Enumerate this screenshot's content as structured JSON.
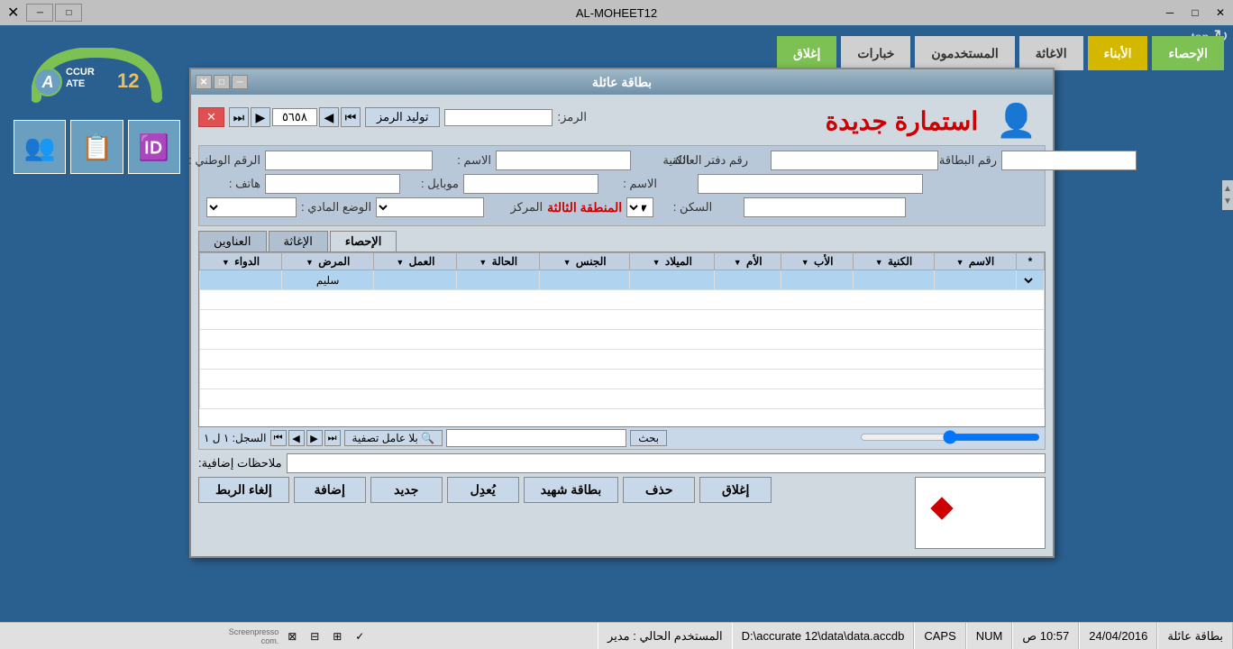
{
  "window": {
    "title": "AL-MOHEET12",
    "close_btn": "✕",
    "minimize_btn": "─",
    "maximize_btn": "□"
  },
  "top_right": {
    "label": "top",
    "refresh_icon": "↻"
  },
  "logo": {
    "text": "ACCURATE 12"
  },
  "nav_buttons": [
    {
      "id": "statistics",
      "label": "الإحصاء",
      "style": "green"
    },
    {
      "id": "children",
      "label": "الأبناء",
      "style": "yellow"
    },
    {
      "id": "relief",
      "label": "الاغاثة",
      "style": "gray"
    },
    {
      "id": "users",
      "label": "المستخدمون",
      "style": "gray"
    },
    {
      "id": "services",
      "label": "خبارات",
      "style": "gray"
    },
    {
      "id": "close_nav",
      "label": "إغلاق",
      "style": "green"
    }
  ],
  "dialog": {
    "title": "بطاقة عائلة",
    "close_icon": "✕",
    "minimize_icon": "─",
    "maximize_icon": "□"
  },
  "form": {
    "title": "استمارة جديدة",
    "toolbar": {
      "close_btn": "✕",
      "first_btn": "⏮",
      "prev_btn": "◀",
      "record_number": "٥٦٥٨",
      "next_btn": "▶",
      "last_btn": "⏭",
      "gen_code_btn": "توليد الرمز",
      "code_label": "الرمز:"
    },
    "fields": {
      "national_id_label": "الرقم الوطني :",
      "name_label": "الاسم :",
      "nickname_label": "الكنية",
      "family_book_label": "رقم دفتر العائلة",
      "family_card_label": "رقم البطاقة الاسرية :",
      "phone_label": "هاتف :",
      "mobile_label": "موبايل :",
      "financial_status_label": "الوضع المادي :",
      "center_label": "المركز",
      "region_label": "المنطقة الثالثة",
      "residence_label": "السكن :"
    },
    "region_text": "المنطقة الثالثة"
  },
  "tabs": [
    {
      "id": "addresses",
      "label": "العناوين",
      "active": false
    },
    {
      "id": "relief",
      "label": "الإغاثة",
      "active": false
    },
    {
      "id": "statistics",
      "label": "الإحصاء",
      "active": true
    }
  ],
  "grid": {
    "columns": [
      {
        "id": "asterisk",
        "label": "*"
      },
      {
        "id": "name",
        "label": "الاسم"
      },
      {
        "id": "nickname",
        "label": "الكنية"
      },
      {
        "id": "father",
        "label": "الأب"
      },
      {
        "id": "mother",
        "label": "الأم"
      },
      {
        "id": "birthdate",
        "label": "الميلاد"
      },
      {
        "id": "gender",
        "label": "الجنس"
      },
      {
        "id": "status",
        "label": "الحالة"
      },
      {
        "id": "work",
        "label": "العمل"
      },
      {
        "id": "disease",
        "label": "المرض"
      },
      {
        "id": "medicine",
        "label": "الدواء"
      }
    ],
    "row1": {
      "name": "",
      "nickname": "",
      "father": "",
      "mother": "",
      "birthdate": "",
      "gender": "",
      "status": "",
      "work": "",
      "disease": "سليم",
      "medicine": "",
      "selected": true
    },
    "footer": {
      "record_label": "السجل:",
      "record_value": "١ ل ١",
      "no_filter_btn": "بلا عامل تصفية",
      "search_btn": "بحث",
      "filter_icon": "🔍"
    }
  },
  "notes": {
    "label": "ملاحظات إضافية:"
  },
  "action_buttons": [
    {
      "id": "add",
      "label": "إضافة"
    },
    {
      "id": "new",
      "label": "جديد"
    },
    {
      "id": "edit",
      "label": "يُعدِل"
    },
    {
      "id": "martyr_card",
      "label": "بطاقة شهيد"
    },
    {
      "id": "delete",
      "label": "حذف"
    },
    {
      "id": "close",
      "label": "إغلاق"
    }
  ],
  "link_button": {
    "label": "إلغاء الربط"
  },
  "status_bar": {
    "app_name": "بطاقة عائلة",
    "date": "24/04/2016",
    "time": "10:57 ص",
    "num": "NUM",
    "caps": "CAPS",
    "path": "D:\\accurate 12\\data\\data.accdb",
    "user_label": "المستخدم الحالي : مدير"
  }
}
